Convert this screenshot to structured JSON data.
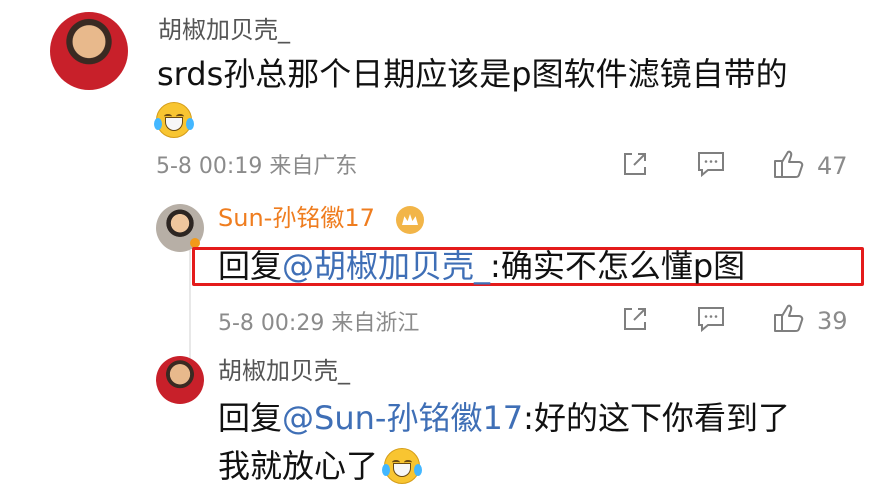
{
  "comment": {
    "username": "胡椒加贝壳_",
    "text": "srds孙总那个日期应该是p图软件滤镜自带的",
    "meta": "5-8 00:19 来自广东",
    "like_count": "47"
  },
  "reply_1": {
    "username": "Sun-孙铭徽17",
    "prefix": "回复",
    "mention": "@胡椒加贝壳_",
    "text": ":确实不怎么懂p图",
    "meta": "5-8 00:29 来自浙江",
    "like_count": "39"
  },
  "reply_2": {
    "username": "胡椒加贝壳_",
    "prefix": "回复",
    "mention": "@Sun-孙铭徽17",
    "text_line_1": ":好的这下你看到了",
    "text_line_2": "我就放心了"
  },
  "colors": {
    "highlight": "#e41b1b",
    "mention": "#3f6fb6",
    "vip_name": "#ef7d1f"
  },
  "icons": {
    "share": "share-icon",
    "comment": "comment-icon",
    "like": "like-icon",
    "emoji": "laughing-tears-emoji"
  }
}
